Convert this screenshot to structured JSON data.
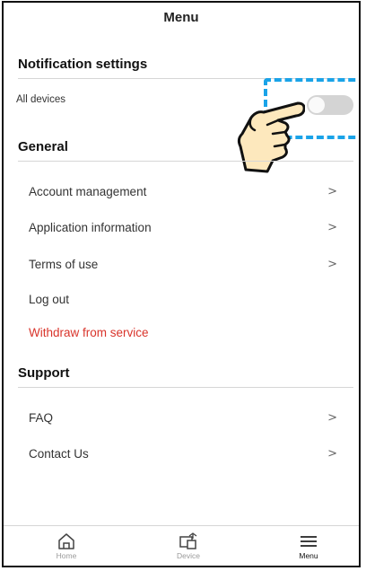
{
  "header": {
    "title": "Menu"
  },
  "notification": {
    "title": "Notification settings",
    "all_devices_label": "All devices",
    "toggle_on": false
  },
  "general": {
    "title": "General",
    "items": [
      {
        "label": "Account management",
        "chevron": ">"
      },
      {
        "label": "Application information",
        "chevron": ">"
      },
      {
        "label": "Terms of use",
        "chevron": ">"
      },
      {
        "label": "Log out"
      },
      {
        "label": "Withdraw from service"
      }
    ]
  },
  "support": {
    "title": "Support",
    "items": [
      {
        "label": "FAQ",
        "chevron": ">"
      },
      {
        "label": "Contact Us",
        "chevron": ">"
      }
    ]
  },
  "nav": {
    "items": [
      {
        "label": "Home",
        "icon": "home-icon"
      },
      {
        "label": "Device",
        "icon": "device-icon"
      },
      {
        "label": "Menu",
        "icon": "menu-icon",
        "active": true
      }
    ]
  },
  "colors": {
    "danger": "#d9342b",
    "highlight": "#1aa3e8",
    "toggle_off": "#d4d4d4"
  }
}
